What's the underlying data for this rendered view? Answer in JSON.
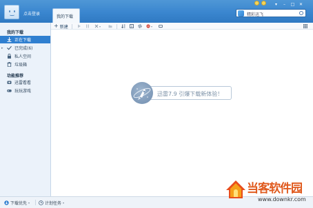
{
  "header": {
    "login_text": "点击登录",
    "active_tab": "我的下载",
    "search_placeholder": "精彩迅飞",
    "window_controls": [
      "minimize-icon",
      "maximize-icon",
      "close-icon"
    ],
    "accent": "#3a86cf"
  },
  "sidebar": {
    "section1_title": "我的下载",
    "items": [
      {
        "label": "正在下载",
        "icon": "download-icon",
        "active": true
      },
      {
        "label": "已完成(6)",
        "icon": "check-icon",
        "active": false
      },
      {
        "label": "私人空间",
        "icon": "lock-icon",
        "active": false
      },
      {
        "label": "垃圾箱",
        "icon": "trash-icon",
        "active": false
      }
    ],
    "section2_title": "功能推荐",
    "items2": [
      {
        "label": "迅雷看看",
        "icon": "film-icon"
      },
      {
        "label": "玩玩游戏",
        "icon": "gamepad-icon"
      }
    ]
  },
  "toolbar": {
    "new_label": "新建"
  },
  "content": {
    "promo_text": "迅雷7.9 引爆下载新体验！"
  },
  "statusbar": {
    "download_priority": "下载优先",
    "scheduled_tasks": "计划任务"
  },
  "watermark": {
    "brand": "当客软件园",
    "url": "www.downkr.com"
  }
}
